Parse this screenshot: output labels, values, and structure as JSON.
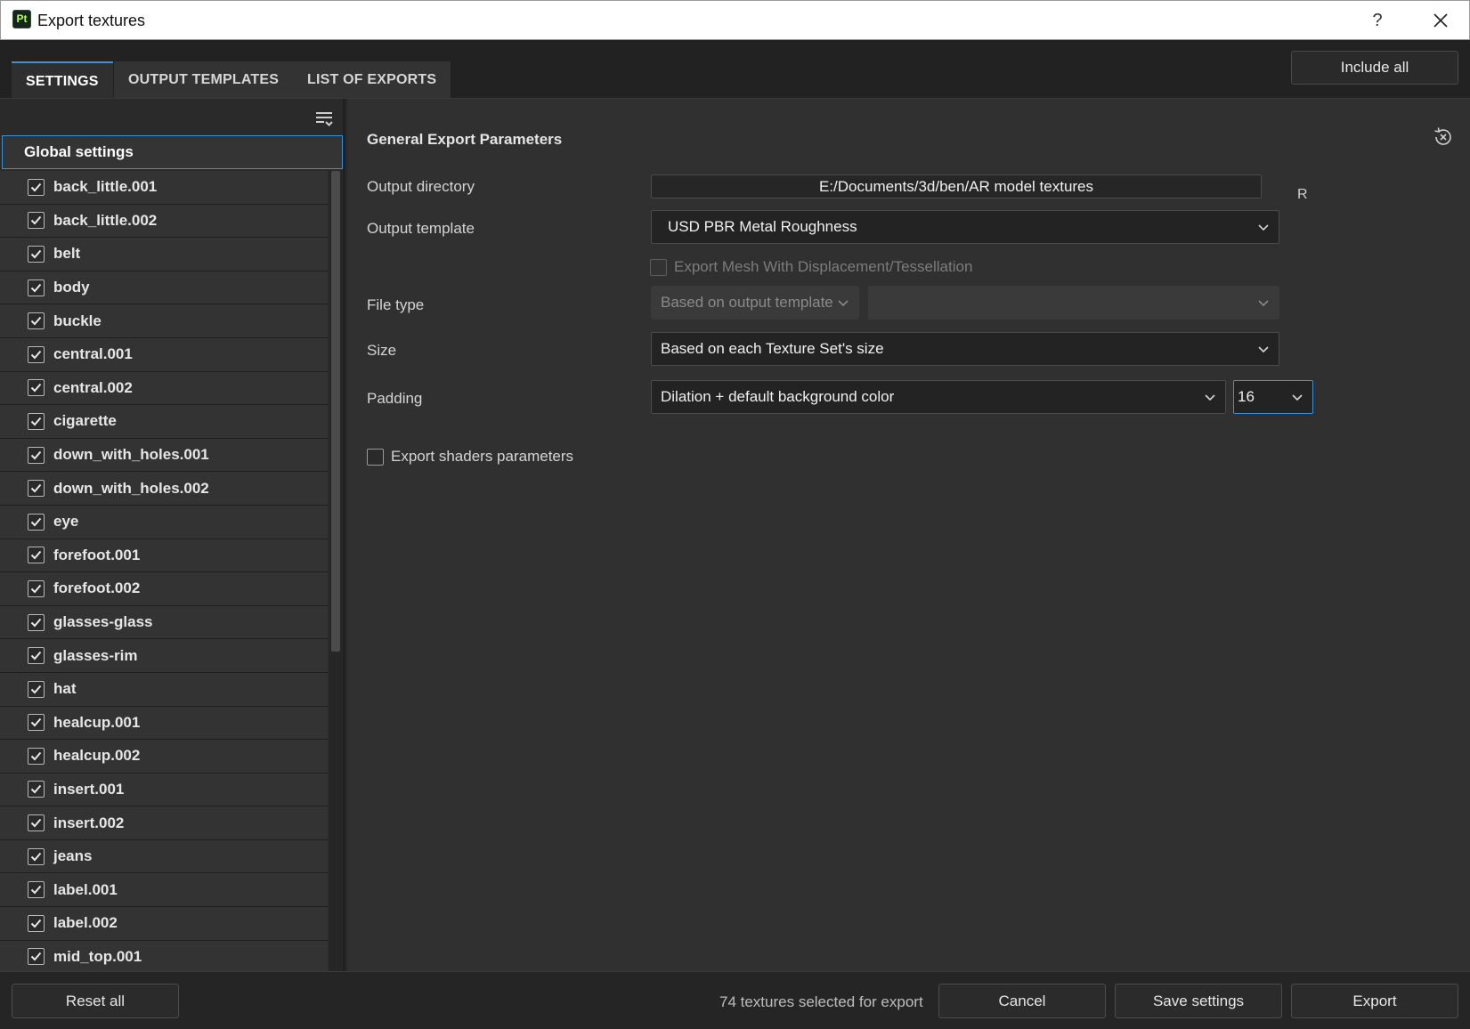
{
  "window": {
    "app_icon": "Pt",
    "title": "Export textures",
    "help_label": "?"
  },
  "tabs": [
    {
      "label": "SETTINGS",
      "active": true
    },
    {
      "label": "OUTPUT TEMPLATES",
      "active": false
    },
    {
      "label": "LIST OF EXPORTS",
      "active": false
    }
  ],
  "include_all_label": "Include all",
  "sidebar": {
    "global_label": "Global settings",
    "items": [
      {
        "label": "back_little.001",
        "checked": true
      },
      {
        "label": "back_little.002",
        "checked": true
      },
      {
        "label": "belt",
        "checked": true
      },
      {
        "label": "body",
        "checked": true
      },
      {
        "label": "buckle",
        "checked": true
      },
      {
        "label": "central.001",
        "checked": true
      },
      {
        "label": "central.002",
        "checked": true
      },
      {
        "label": "cigarette",
        "checked": true
      },
      {
        "label": "down_with_holes.001",
        "checked": true
      },
      {
        "label": "down_with_holes.002",
        "checked": true
      },
      {
        "label": "eye",
        "checked": true
      },
      {
        "label": "forefoot.001",
        "checked": true
      },
      {
        "label": "forefoot.002",
        "checked": true
      },
      {
        "label": "glasses-glass",
        "checked": true
      },
      {
        "label": "glasses-rim",
        "checked": true
      },
      {
        "label": "hat",
        "checked": true
      },
      {
        "label": "healcup.001",
        "checked": true
      },
      {
        "label": "healcup.002",
        "checked": true
      },
      {
        "label": "insert.001",
        "checked": true
      },
      {
        "label": "insert.002",
        "checked": true
      },
      {
        "label": "jeans",
        "checked": true
      },
      {
        "label": "label.001",
        "checked": true
      },
      {
        "label": "label.002",
        "checked": true
      },
      {
        "label": "mid_top.001",
        "checked": true
      }
    ]
  },
  "params": {
    "section_title": "General Export Parameters",
    "output_directory_label": "Output directory",
    "output_directory_value": "E:/Documents/3d/ben/AR model textures",
    "output_directory_suffix": "R",
    "output_template_label": "Output template",
    "output_template_value": "USD PBR Metal Roughness",
    "export_mesh_label": "Export Mesh With Displacement/Tessellation",
    "file_type_label": "File type",
    "file_type_value": "Based on output template",
    "file_type_secondary_value": "",
    "size_label": "Size",
    "size_value": "Based on each Texture Set's size",
    "padding_label": "Padding",
    "padding_value": "Dilation + default background color",
    "padding_amount": "16",
    "export_shaders_label": "Export shaders parameters"
  },
  "footer": {
    "reset_all_label": "Reset all",
    "status_text": "74 textures selected for export",
    "cancel_label": "Cancel",
    "save_settings_label": "Save settings",
    "export_label": "Export"
  },
  "colors": {
    "accent": "#3d8fd8",
    "background": "#2b2b2b",
    "app_icon_green": "#b4ff5a"
  }
}
